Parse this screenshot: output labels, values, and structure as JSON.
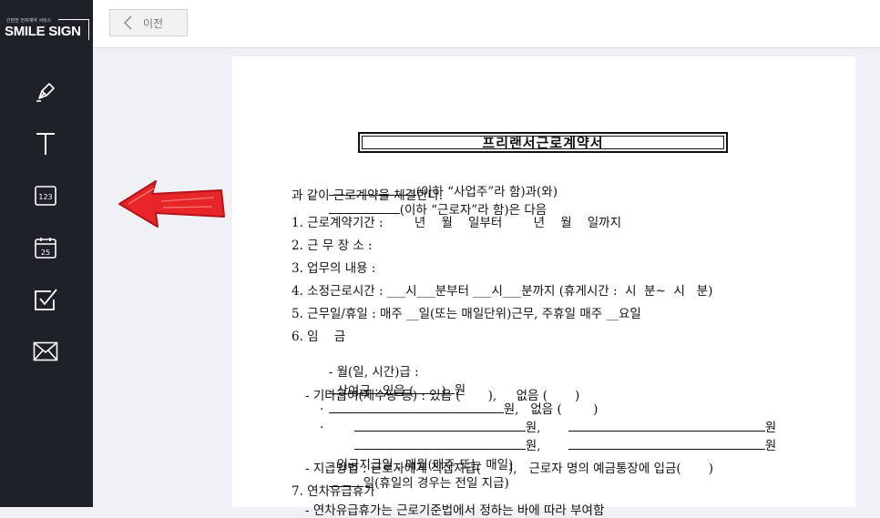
{
  "brand": {
    "tagline": "간편한 전자계약 서비스",
    "name": "SMILE SIGN"
  },
  "toolbar": {
    "tools": [
      {
        "icon": "pen-icon",
        "label": "signature"
      },
      {
        "icon": "text-icon",
        "glyph": "T"
      },
      {
        "icon": "number-icon",
        "glyph": "123"
      },
      {
        "icon": "date-icon",
        "glyph": "25"
      },
      {
        "icon": "checkbox-icon"
      },
      {
        "icon": "mail-icon"
      }
    ]
  },
  "topbar": {
    "back_label": "이전"
  },
  "annotation": {
    "arrow_color": "#e8262a",
    "icon": "red-arrow-left"
  },
  "document": {
    "title": "프리랜서근로계약서",
    "intro_line1": "(이하 “사업주”라 함)과(와)",
    "intro_line1b": "(이하 “근로자”라 함)은 다음",
    "intro_line2": "과 같이 근로계약을 체결한다.",
    "item1": "1. 근로계약기간 :        년    월    일부터        년    월    일까지",
    "item2": "2. 근 무 장 소 :",
    "item3": "3. 업무의 내용 :",
    "item4": "4. 소정근로시간 : ___시___분부터 ___시___분까지 (휴게시간 :  시  분~  시   분)",
    "item5": "5. 근무일/휴일 : 매주 __일(또는 매일단위)근무, 주휴일 매주 __요일",
    "item6": "6. 임    금",
    "wage_monthly": "- 월(일, 시간)급 :",
    "wage_monthly_unit": "원",
    "bonus": "- 상여금 : 있음 (       )",
    "bonus_unit": "원,   없음 (        )",
    "other_pay": "- 기타급여(제수당 등) : 있음 (       ),     없음 (       )",
    "bullet": "·",
    "won": "원",
    "won_comma": "원,",
    "pay_day": "- 임금지급일 : 매월(매주 또는 매일)",
    "pay_day_b": "일(휴일의 경우는 전일 지급)",
    "pay_method": "- 지급방법 : 근로자에게 직접지급(       ),   근로자 명의 예금통장에 입금(       )",
    "item7": "7. 연차유급휴가",
    "item7_sub": "- 연차유급휴가는 근로기준법에서 정하는 바에 따라 부여함"
  },
  "colors": {
    "sidebar": "#1f2129",
    "workspace": "#f0f1f5",
    "arrow": "#e8262a"
  }
}
